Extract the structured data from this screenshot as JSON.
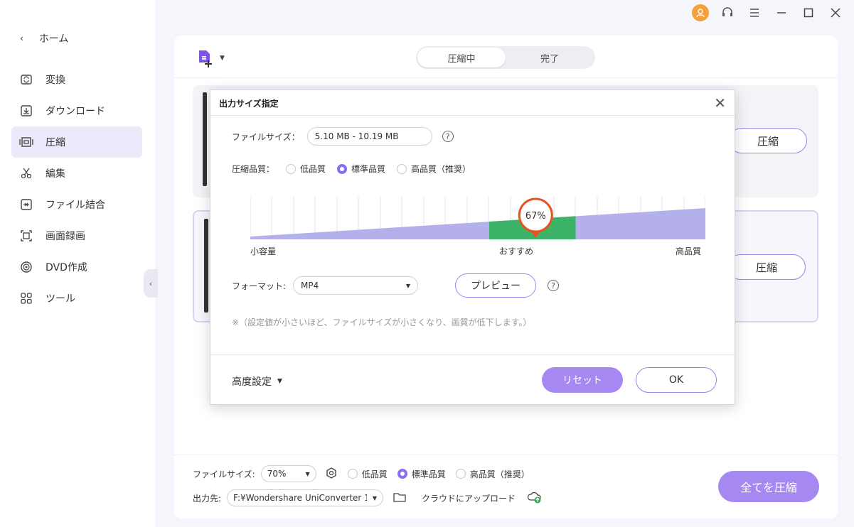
{
  "sidebar": {
    "home_label": "ホーム",
    "items": [
      {
        "label": "変換",
        "icon": "convert-icon"
      },
      {
        "label": "ダウンロード",
        "icon": "download-icon"
      },
      {
        "label": "圧縮",
        "icon": "compress-icon",
        "active": true
      },
      {
        "label": "編集",
        "icon": "scissors-icon"
      },
      {
        "label": "ファイル結合",
        "icon": "merge-icon"
      },
      {
        "label": "画面録画",
        "icon": "screen-record-icon"
      },
      {
        "label": "DVD作成",
        "icon": "dvd-icon"
      },
      {
        "label": "ツール",
        "icon": "tools-icon"
      }
    ]
  },
  "header": {
    "tabs": [
      {
        "label": "圧縮中",
        "active": true
      },
      {
        "label": "完了",
        "active": false
      }
    ]
  },
  "cards": [
    {
      "button_label": "圧縮"
    },
    {
      "button_label": "圧縮"
    }
  ],
  "bottom": {
    "file_size_label": "ファイルサイズ:",
    "file_size_value": "70%",
    "quality_options": [
      "低品質",
      "標準品質",
      "高品質（推奨）"
    ],
    "quality_selected": 1,
    "output_label": "出力先:",
    "output_path": "F:¥Wondershare UniConverter 1",
    "cloud_label": "クラウドにアップロード",
    "compress_all_label": "全てを圧縮"
  },
  "dialog": {
    "title": "出力サイズ指定",
    "file_size_label": "ファイルサイズ：",
    "file_size_value": "5.10 MB - 10.19 MB",
    "quality_label": "圧縮品質：",
    "quality_options": [
      "低品質",
      "標準品質",
      "高品質（推奨）"
    ],
    "quality_selected": 1,
    "slider_value": 67,
    "slider_value_label": "67%",
    "slider_left_label": "小容量",
    "slider_mid_label": "おすすめ",
    "slider_right_label": "高品質",
    "format_label": "フォーマット:",
    "format_value": "MP4",
    "preview_label": "プレビュー",
    "note": "※（設定値が小さいほど、ファイルサイズが小さくなり、画質が低下します。）",
    "advanced_label": "高度設定",
    "reset_label": "リセット",
    "ok_label": "OK"
  },
  "colors": {
    "accent": "#a688f3",
    "slider_fill": "#b3b0ec",
    "slider_recommended": "#3db36a",
    "thumb": "#e8531d"
  }
}
